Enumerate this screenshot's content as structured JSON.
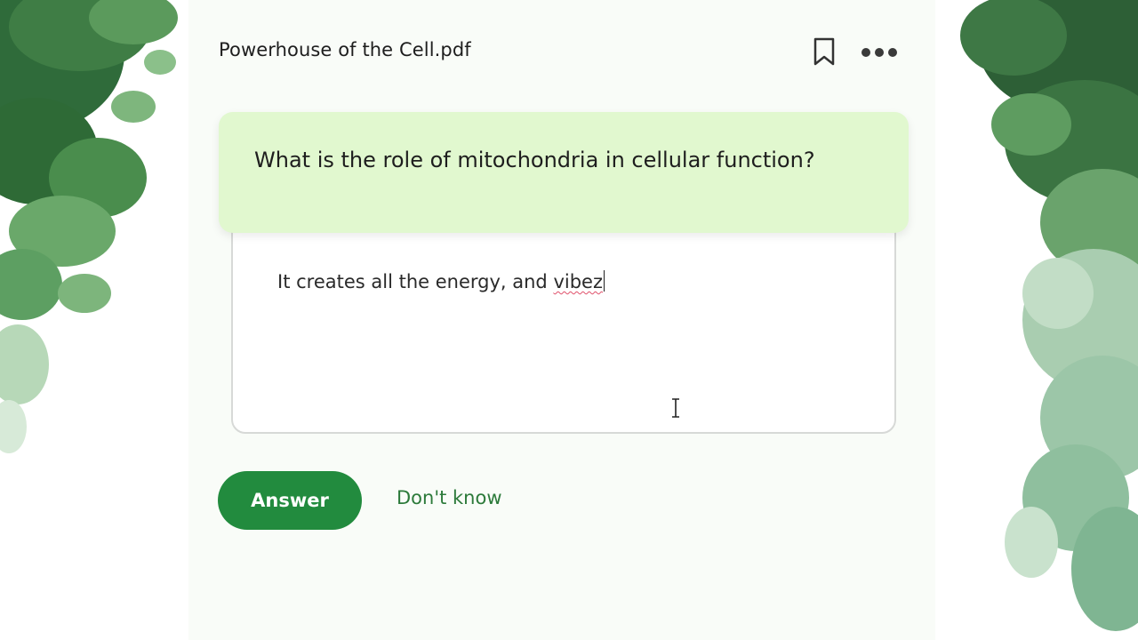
{
  "header": {
    "document_title": "Powerhouse of the Cell.pdf",
    "bookmark_icon": "bookmark-icon",
    "more_icon": "more-dots-icon"
  },
  "question": {
    "text": "What is the role of mitochondria in cellular function?"
  },
  "answer_field": {
    "value_main": "It creates all the energy, and ",
    "value_misspelled": "vibez"
  },
  "actions": {
    "answer_label": "Answer",
    "dont_know_label": "Don't know"
  },
  "colors": {
    "accent": "#228b3e",
    "question_bg": "#e1f8cf",
    "link": "#2c7a3a"
  }
}
